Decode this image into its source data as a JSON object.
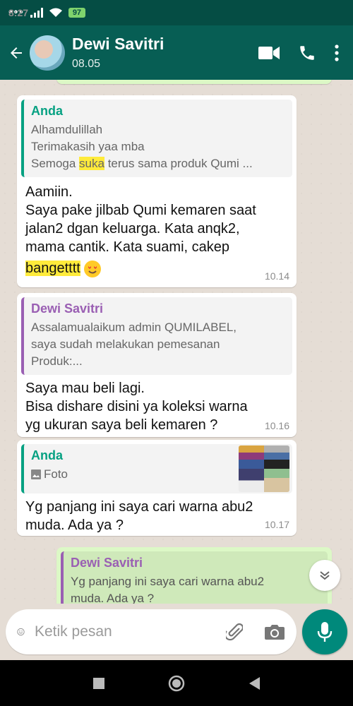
{
  "status_bar": {
    "time": "8:27",
    "battery": "97"
  },
  "header": {
    "contact_name": "Dewi Savitri",
    "contact_status": "08.05"
  },
  "messages": [
    {
      "direction": "in",
      "quote": {
        "name": "Anda",
        "lines": [
          "Alhamdulillah",
          "Terimakasih yaa mba",
          "Semoga suka terus sama produk Qumi ..."
        ]
      },
      "text_lines": [
        "Aamiin.",
        "Saya pake jilbab Qumi kemaren saat",
        "jalan2 dgan keluarga. Kata anqk2,",
        "mama cantik. Kata suami, cakep",
        "bangetttt"
      ],
      "time": "10.14"
    },
    {
      "direction": "in",
      "quote": {
        "name": "Dewi Savitri",
        "lines": [
          "Assalamualaikum admin QUMILABEL,",
          "saya sudah melakukan pemesanan",
          "Produk:..."
        ]
      },
      "text_lines": [
        "Saya mau beli lagi.",
        "Bisa dishare disini ya koleksi warna",
        "yg  ukuran saya beli kemaren ?"
      ],
      "time": "10.16"
    },
    {
      "direction": "in",
      "quote": {
        "name": "Anda",
        "media_label": "Foto"
      },
      "text_lines": [
        "Yg panjang ini saya cari warna abu2",
        "muda. Ada ya ?"
      ],
      "time": "10.17"
    },
    {
      "direction": "out",
      "quote": {
        "name": "Dewi Savitri",
        "lines": [
          "Yg panjang ini saya cari warna abu2",
          "muda. Ada ya ?"
        ]
      }
    }
  ],
  "composer": {
    "placeholder": "Ketik pesan"
  },
  "colors": {
    "header": "#075e54",
    "accent": "#00897b",
    "outgoing_bubble": "#dcf8c6",
    "highlight": "#ffeb3b"
  },
  "icons": [
    "back-arrow-icon",
    "video-call-icon",
    "phone-icon",
    "more-options-icon",
    "emoji-icon",
    "attach-icon",
    "camera-icon",
    "mic-icon",
    "scroll-down-icon",
    "photo-icon"
  ]
}
